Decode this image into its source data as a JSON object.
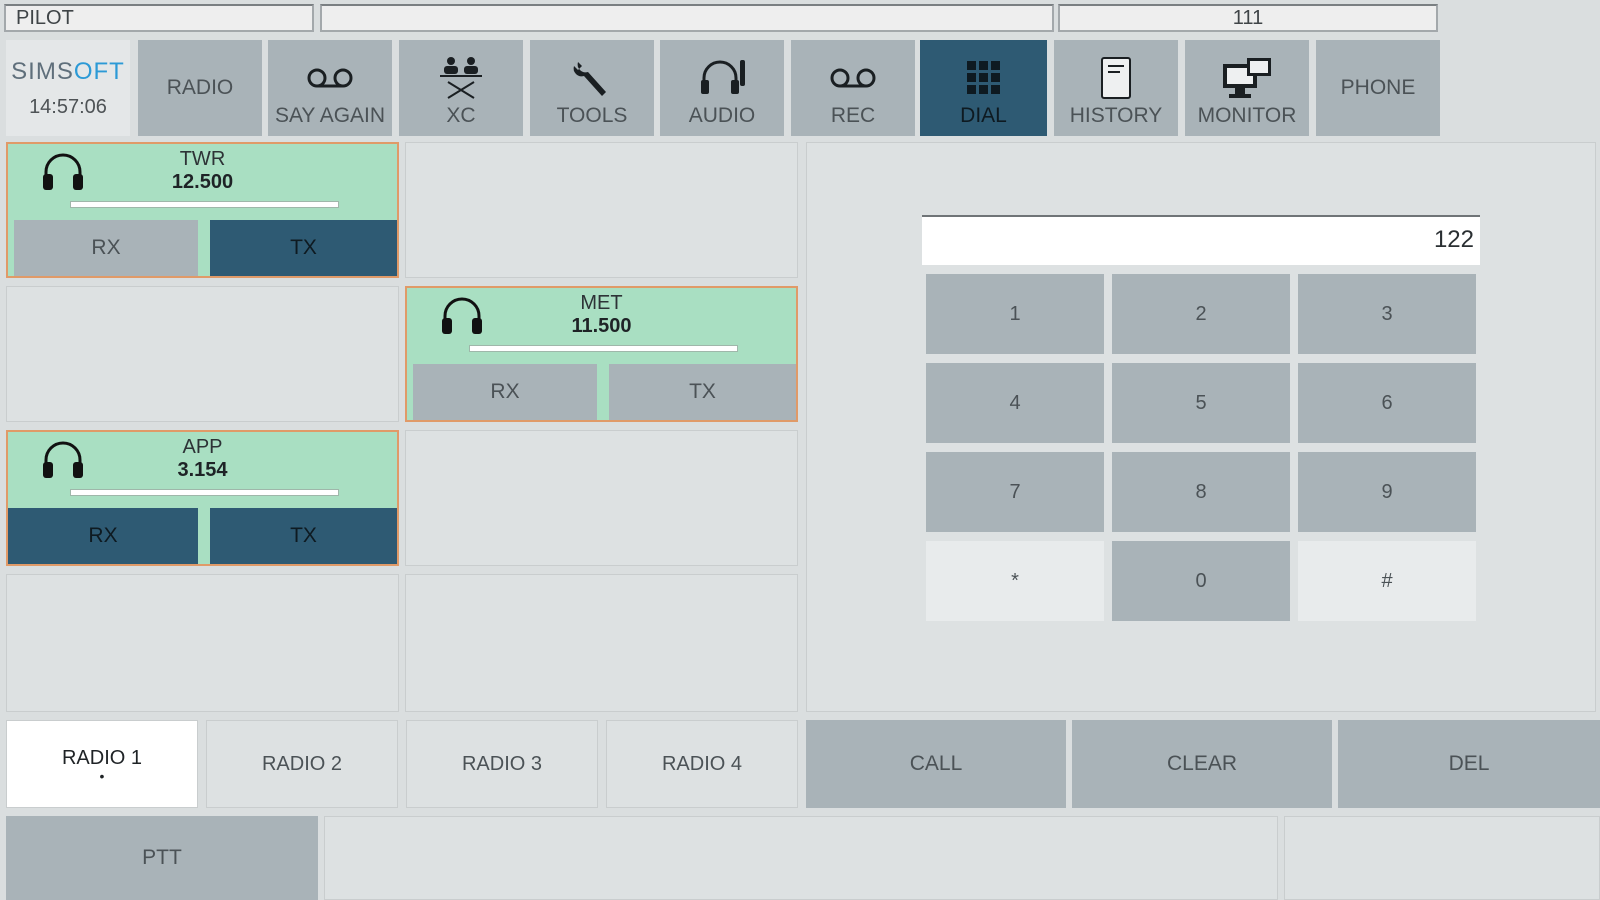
{
  "top_fields": {
    "role": "PILOT",
    "middle": "",
    "code": "111"
  },
  "brand": {
    "logo_prefix": "SIMS",
    "logo_accent": "OFT",
    "clock": "14:57:06"
  },
  "nav": {
    "radio": "RADIO",
    "say_again": "SAY AGAIN",
    "xc": "XC",
    "tools": "TOOLS",
    "audio": "AUDIO",
    "rec": "REC",
    "dial": "DIAL",
    "history": "HISTORY",
    "monitor": "MONITOR",
    "phone": "PHONE",
    "active": "DIAL"
  },
  "radios": [
    {
      "name": "TWR",
      "freq": "12.500",
      "rx_label": "RX",
      "tx_label": "TX",
      "rx_active": false,
      "tx_active": true
    },
    {
      "name": "MET",
      "freq": "11.500",
      "rx_label": "RX",
      "tx_label": "TX",
      "rx_active": false,
      "tx_active": false
    },
    {
      "name": "APP",
      "freq": "3.154",
      "rx_label": "RX",
      "tx_label": "TX",
      "rx_active": true,
      "tx_active": true
    }
  ],
  "dial": {
    "display": "122",
    "keys": [
      "1",
      "2",
      "3",
      "4",
      "5",
      "6",
      "7",
      "8",
      "9",
      "*",
      "0",
      "#"
    ]
  },
  "tabs": [
    {
      "label": "RADIO 1",
      "marker": "•",
      "selected": true
    },
    {
      "label": "RADIO 2",
      "marker": "",
      "selected": false
    },
    {
      "label": "RADIO 3",
      "marker": "",
      "selected": false
    },
    {
      "label": "RADIO 4",
      "marker": "",
      "selected": false
    }
  ],
  "actions": {
    "call": "CALL",
    "clear": "CLEAR",
    "del": "DEL"
  },
  "footer": {
    "ptt": "PTT"
  },
  "colors": {
    "active": "#2e5a73",
    "card": "#a9dfc2",
    "card_border": "#e09a68",
    "button": "#a9b3b8",
    "panel": "#dde1e2"
  }
}
